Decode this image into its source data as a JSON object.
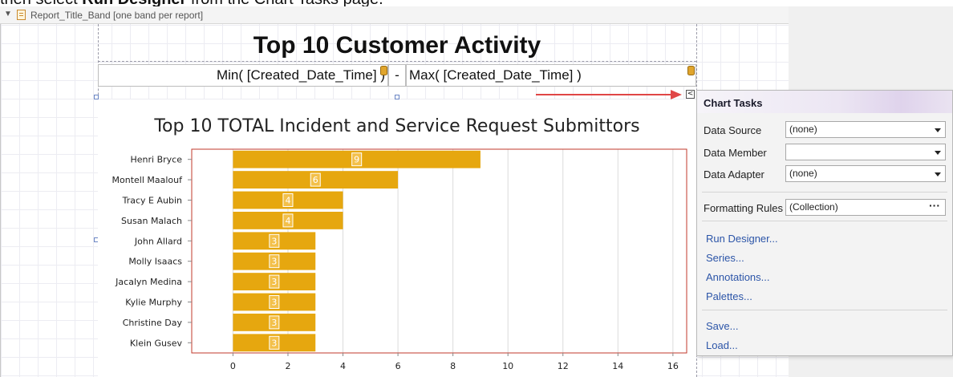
{
  "instruction": {
    "prefix": "then select ",
    "bold": "Run Designer",
    "suffix": " from the Chart Tasks page."
  },
  "band": {
    "label": "Report_Title_Band [one band per report]"
  },
  "report": {
    "title": "Top 10 Customer Activity",
    "min_expr": "Min( [Created_Date_Time] )",
    "dash": "-",
    "max_expr": "Max( [Created_Date_Time] )"
  },
  "chart_data": {
    "type": "bar",
    "orientation": "horizontal",
    "title": "Top 10 TOTAL Incident and Service Request Submittors",
    "categories": [
      "Henri Bryce",
      "Montell Maalouf",
      "Tracy E Aubin",
      "Susan Malach",
      "John Allard",
      "Molly Isaacs",
      "Jacalyn Medina",
      "Kylie Murphy",
      "Christine Day",
      "Klein Gusev"
    ],
    "values": [
      9,
      6,
      4,
      4,
      3,
      3,
      3,
      3,
      3,
      3
    ],
    "xticks": [
      0,
      2,
      4,
      6,
      8,
      10,
      12,
      14,
      16
    ],
    "xlim": [
      -1.5,
      16.5
    ],
    "grid": true,
    "bar_color": "#e6a70f",
    "axis_color": "#c0392b"
  },
  "chart_tasks": {
    "title": "Chart Tasks",
    "data_source": {
      "label": "Data Source",
      "value": "(none)"
    },
    "data_member": {
      "label": "Data Member",
      "value": ""
    },
    "data_adapter": {
      "label": "Data Adapter",
      "value": "(none)"
    },
    "formatting_rules": {
      "label": "Formatting Rules",
      "value": "(Collection)",
      "button": "···"
    },
    "links": [
      "Run Designer...",
      "Series...",
      "Annotations...",
      "Palettes..."
    ],
    "links2": [
      "Save...",
      "Load..."
    ]
  }
}
